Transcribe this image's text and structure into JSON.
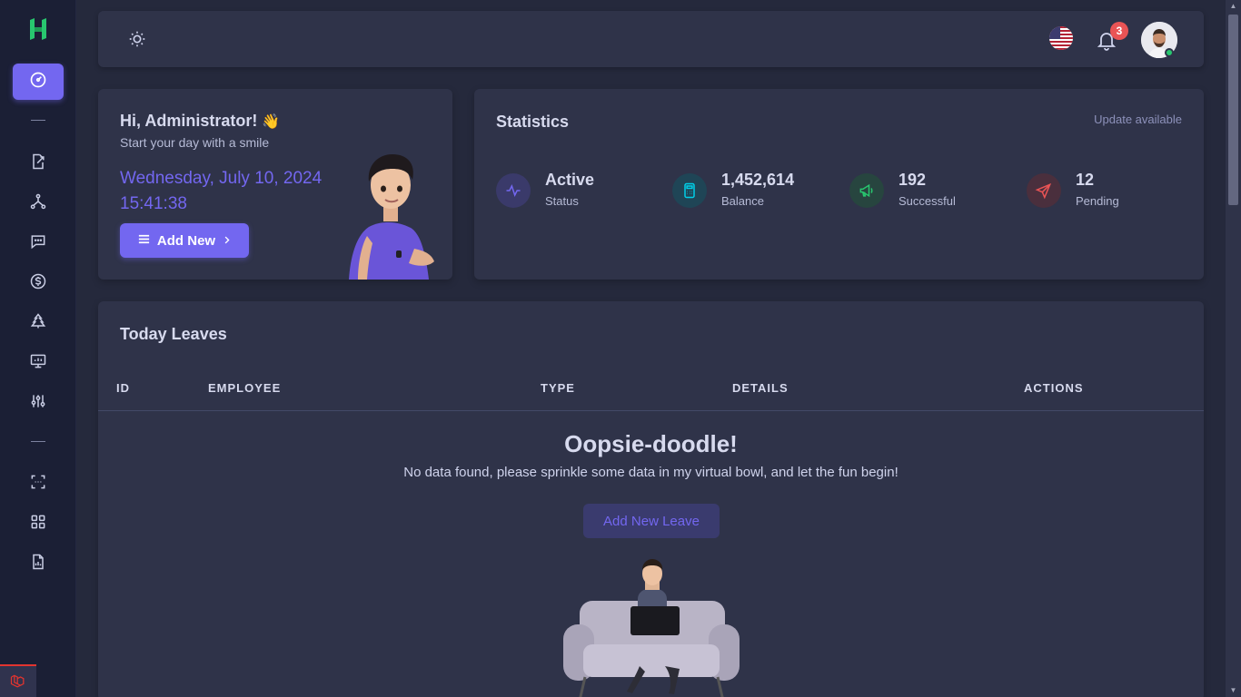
{
  "topbar": {
    "notification_count": "3",
    "icons": [
      "sun-icon",
      "us-flag-icon",
      "bell-icon",
      "user-avatar"
    ]
  },
  "sidebar": {
    "items": [
      "dashboard-icon",
      "export-icon",
      "structure-icon",
      "chat-icon",
      "salary-icon",
      "holiday-tree-icon",
      "presentation-icon",
      "settings-sliders-icon",
      "scan-icon",
      "apps-grid-icon",
      "report-icon"
    ]
  },
  "welcome": {
    "greeting": "Hi, Administrator!",
    "wave_emoji": "👋",
    "subtitle": "Start your day with a smile",
    "date": "Wednesday, July 10, 2024",
    "time": "15:41:38",
    "add_label": "Add New"
  },
  "statistics": {
    "title": "Statistics",
    "update_link": "Update available",
    "items": [
      {
        "value": "Active",
        "label": "Status",
        "color": "#7367f0"
      },
      {
        "value": "1,452,614",
        "label": "Balance",
        "color": "#00cfe8"
      },
      {
        "value": "192",
        "label": "Successful",
        "color": "#28c76f"
      },
      {
        "value": "12",
        "label": "Pending",
        "color": "#ea5455"
      }
    ]
  },
  "leaves": {
    "title": "Today Leaves",
    "columns": [
      "ID",
      "EMPLOYEE",
      "TYPE",
      "DETAILS",
      "ACTIONS"
    ],
    "empty_title": "Oopsie-doodle!",
    "empty_message": "No data found, please sprinkle some data in my virtual bowl, and let the fun begin!",
    "add_leave_label": "Add New Leave"
  },
  "colors": {
    "primary": "#7367f0",
    "background": "#25293c",
    "card": "#2f3349",
    "sidebar": "#1b1f35"
  }
}
